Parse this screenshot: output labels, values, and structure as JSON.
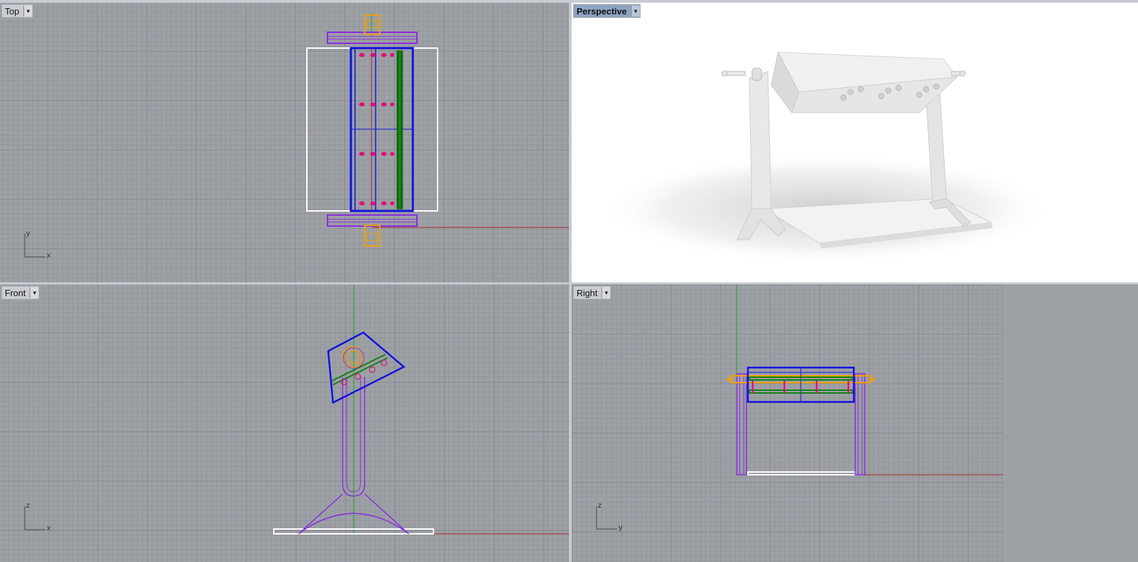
{
  "viewports": {
    "top": {
      "title": "Top",
      "axis_h": "x",
      "axis_v": "y"
    },
    "perspective": {
      "title": "Perspective"
    },
    "front": {
      "title": "Front",
      "axis_h": "x",
      "axis_v": "z"
    },
    "right": {
      "title": "Right",
      "axis_h": "y",
      "axis_v": "z"
    }
  },
  "icons": {
    "menu_arrow": "chevron-down-icon"
  },
  "colors": {
    "active_tab": "#8fa4c2",
    "grid_bg": "#9da1a6",
    "x_axis": "#b02020",
    "y_axis": "#1a9a1a",
    "purple_geometry": "#8a2be2",
    "blue_geometry": "#1010e0",
    "orange_geometry": "#f0a000",
    "magenta_geometry": "#e0107a",
    "green_geometry": "#108010"
  }
}
